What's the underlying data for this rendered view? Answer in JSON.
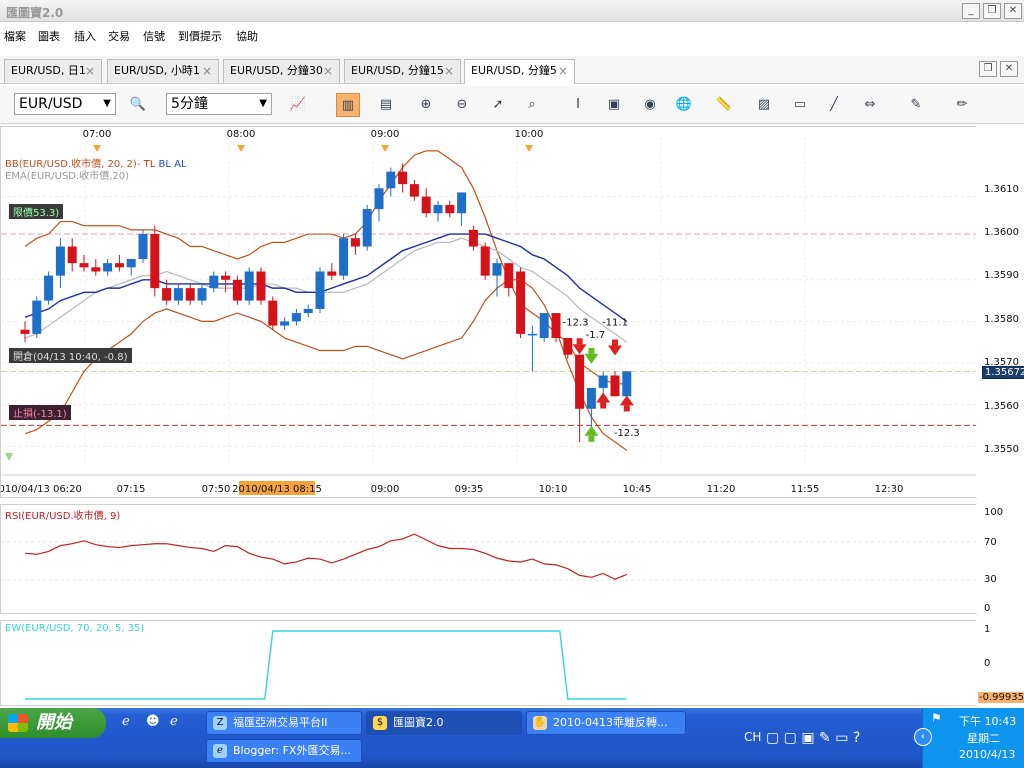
{
  "window": {
    "title": "匯圖寶2.0"
  },
  "menu": [
    "檔案",
    "圖表",
    "插入",
    "交易",
    "信號",
    "到價提示",
    "協助"
  ],
  "tabs": [
    "EUR/USD, 日1",
    "EUR/USD, 小時1",
    "EUR/USD, 分鐘30",
    "EUR/USD, 分鐘15",
    "EUR/USD, 分鐘5"
  ],
  "toolbar": {
    "symbol": "EUR/USD",
    "period": "5分鐘"
  },
  "main_chart": {
    "top_time_labels": [
      "07:00",
      "08:00",
      "09:00",
      "10:00"
    ],
    "bb_label": "BB(EUR/USD.收市價, 20, 2)-",
    "bb_tags": [
      "TL",
      "BL",
      "AL"
    ],
    "ema_label": "EMA(EUR/USD.收市價,20)",
    "order_limit": "限價53.3)",
    "order_entry": "開倉(04/13 10:40, -0.8)",
    "order_stop": "止損(-13.1)",
    "price_ticks": [
      "1.3610",
      "1.3600",
      "1.3590",
      "1.3580",
      "1.3570",
      "1.3560",
      "1.3550"
    ],
    "current_price": "1.35672",
    "bottom_time_labels": [
      "2010/04/13 06:20",
      "07:15",
      "07:50",
      "2010/04/13 08:15",
      "09:00",
      "09:35",
      "10:10",
      "10:45",
      "11:20",
      "11:55",
      "12:30"
    ],
    "signal_labels": [
      "-12.3",
      "-1.7",
      "-11.1",
      "-12.3"
    ]
  },
  "rsi": {
    "label": "RSI(EUR/USD.收市價, 9)",
    "ticks": [
      "100",
      "70",
      "30",
      "0"
    ]
  },
  "ew": {
    "label": "EW(EUR/USD, 70, 20, 5, 35)",
    "ticks": [
      "1",
      "0",
      "-0.99935"
    ]
  },
  "taskbar": {
    "start": "開始",
    "tasks": [
      "福匯亞洲交易平台II",
      "匯圖寶2.0",
      "2010-0413乖離反轉...",
      "Blogger: FX外匯交易..."
    ],
    "lang": "CH",
    "time": "下午 10:43",
    "weekday": "星期二",
    "date": "2010/4/13"
  },
  "colors": {
    "bull": "#1d6fc7",
    "bear": "#d5121a",
    "bb": "#c0501e",
    "ema": "#1b2fa8",
    "ew": "#38d6d6",
    "rsi": "#c22020"
  },
  "chart_data": {
    "type": "candlestick",
    "x": [
      "06:25",
      "06:30",
      "06:35",
      "06:40",
      "06:45",
      "06:50",
      "06:55",
      "07:00",
      "07:05",
      "07:10",
      "07:15",
      "07:20",
      "07:25",
      "07:30",
      "07:35",
      "07:40",
      "07:45",
      "07:50",
      "07:55",
      "08:00",
      "08:05",
      "08:10",
      "08:15",
      "08:20",
      "08:25",
      "08:30",
      "08:35",
      "08:40",
      "08:45",
      "08:50",
      "08:55",
      "09:00",
      "09:05",
      "09:10",
      "09:15",
      "09:20",
      "09:25",
      "09:30",
      "09:35",
      "09:40",
      "09:45",
      "09:50",
      "09:55",
      "10:00",
      "10:05",
      "10:10",
      "10:15",
      "10:20",
      "10:25",
      "10:30",
      "10:35",
      "10:40"
    ],
    "candles": [
      {
        "o": 1.3578,
        "h": 1.358,
        "l": 1.3575,
        "c": 1.3577
      },
      {
        "o": 1.3577,
        "h": 1.3586,
        "l": 1.3576,
        "c": 1.3585
      },
      {
        "o": 1.3585,
        "h": 1.3592,
        "l": 1.3584,
        "c": 1.3591
      },
      {
        "o": 1.3591,
        "h": 1.36,
        "l": 1.3588,
        "c": 1.3598
      },
      {
        "o": 1.3598,
        "h": 1.36,
        "l": 1.3592,
        "c": 1.3594
      },
      {
        "o": 1.3594,
        "h": 1.3596,
        "l": 1.3592,
        "c": 1.3593
      },
      {
        "o": 1.3593,
        "h": 1.3595,
        "l": 1.3591,
        "c": 1.3592
      },
      {
        "o": 1.3592,
        "h": 1.3595,
        "l": 1.3591,
        "c": 1.3594
      },
      {
        "o": 1.3594,
        "h": 1.3596,
        "l": 1.3592,
        "c": 1.3593
      },
      {
        "o": 1.3593,
        "h": 1.3595,
        "l": 1.3591,
        "c": 1.3595
      },
      {
        "o": 1.3595,
        "h": 1.3602,
        "l": 1.3594,
        "c": 1.3601
      },
      {
        "o": 1.3601,
        "h": 1.3603,
        "l": 1.3586,
        "c": 1.3588
      },
      {
        "o": 1.3588,
        "h": 1.359,
        "l": 1.3584,
        "c": 1.3585
      },
      {
        "o": 1.3585,
        "h": 1.3589,
        "l": 1.3584,
        "c": 1.3588
      },
      {
        "o": 1.3588,
        "h": 1.3589,
        "l": 1.3584,
        "c": 1.3585
      },
      {
        "o": 1.3585,
        "h": 1.3589,
        "l": 1.3584,
        "c": 1.3588
      },
      {
        "o": 1.3588,
        "h": 1.3592,
        "l": 1.3587,
        "c": 1.3591
      },
      {
        "o": 1.3591,
        "h": 1.3592,
        "l": 1.3587,
        "c": 1.359
      },
      {
        "o": 1.359,
        "h": 1.3591,
        "l": 1.3584,
        "c": 1.3585
      },
      {
        "o": 1.3585,
        "h": 1.3593,
        "l": 1.3584,
        "c": 1.3592
      },
      {
        "o": 1.3592,
        "h": 1.3593,
        "l": 1.3584,
        "c": 1.3585
      },
      {
        "o": 1.3585,
        "h": 1.3586,
        "l": 1.3578,
        "c": 1.3579
      },
      {
        "o": 1.3579,
        "h": 1.3581,
        "l": 1.3578,
        "c": 1.358
      },
      {
        "o": 1.358,
        "h": 1.3583,
        "l": 1.3579,
        "c": 1.3582
      },
      {
        "o": 1.3582,
        "h": 1.3584,
        "l": 1.3581,
        "c": 1.3583
      },
      {
        "o": 1.3583,
        "h": 1.3593,
        "l": 1.3582,
        "c": 1.3592
      },
      {
        "o": 1.3592,
        "h": 1.3594,
        "l": 1.359,
        "c": 1.3591
      },
      {
        "o": 1.3591,
        "h": 1.3601,
        "l": 1.359,
        "c": 1.36
      },
      {
        "o": 1.36,
        "h": 1.3601,
        "l": 1.3596,
        "c": 1.3598
      },
      {
        "o": 1.3598,
        "h": 1.3608,
        "l": 1.3597,
        "c": 1.3607
      },
      {
        "o": 1.3607,
        "h": 1.3613,
        "l": 1.3604,
        "c": 1.3612
      },
      {
        "o": 1.3612,
        "h": 1.3617,
        "l": 1.361,
        "c": 1.3616
      },
      {
        "o": 1.3616,
        "h": 1.3618,
        "l": 1.3611,
        "c": 1.3613
      },
      {
        "o": 1.3613,
        "h": 1.3614,
        "l": 1.3609,
        "c": 1.361
      },
      {
        "o": 1.361,
        "h": 1.3612,
        "l": 1.3605,
        "c": 1.3606
      },
      {
        "o": 1.3606,
        "h": 1.3609,
        "l": 1.3604,
        "c": 1.3608
      },
      {
        "o": 1.3608,
        "h": 1.3609,
        "l": 1.3605,
        "c": 1.3606
      },
      {
        "o": 1.3606,
        "h": 1.3611,
        "l": 1.3603,
        "c": 1.3611
      },
      {
        "o": 1.3602,
        "h": 1.3603,
        "l": 1.3597,
        "c": 1.3598
      },
      {
        "o": 1.3598,
        "h": 1.3599,
        "l": 1.359,
        "c": 1.3591
      },
      {
        "o": 1.3591,
        "h": 1.3595,
        "l": 1.3586,
        "c": 1.3594
      },
      {
        "o": 1.3594,
        "h": 1.3594,
        "l": 1.3586,
        "c": 1.3588
      },
      {
        "o": 1.3592,
        "h": 1.3593,
        "l": 1.3576,
        "c": 1.3577
      },
      {
        "o": 1.3577,
        "h": 1.3579,
        "l": 1.3568,
        "c": 1.3577
      },
      {
        "o": 1.3576,
        "h": 1.3582,
        "l": 1.3575,
        "c": 1.3582
      },
      {
        "o": 1.3582,
        "h": 1.3582,
        "l": 1.3575,
        "c": 1.3576
      },
      {
        "o": 1.3576,
        "h": 1.3576,
        "l": 1.3571,
        "c": 1.3572
      },
      {
        "o": 1.3572,
        "h": 1.3572,
        "l": 1.3551,
        "c": 1.3559
      },
      {
        "o": 1.3559,
        "h": 1.3564,
        "l": 1.3553,
        "c": 1.3564
      },
      {
        "o": 1.3564,
        "h": 1.3568,
        "l": 1.3561,
        "c": 1.3567
      },
      {
        "o": 1.3567,
        "h": 1.3568,
        "l": 1.3562,
        "c": 1.3562
      },
      {
        "o": 1.3562,
        "h": 1.3568,
        "l": 1.3561,
        "c": 1.3568
      }
    ],
    "bb_upper": [
      1.3598,
      1.36,
      1.3601,
      1.3604,
      1.3604,
      1.3603,
      1.3603,
      1.3603,
      1.3603,
      1.3602,
      1.3602,
      1.3602,
      1.3601,
      1.36,
      1.3598,
      1.3598,
      1.3597,
      1.3596,
      1.3595,
      1.3596,
      1.3598,
      1.3599,
      1.3599,
      1.36,
      1.3601,
      1.3601,
      1.3601,
      1.36,
      1.3601,
      1.3604,
      1.3609,
      1.3613,
      1.3617,
      1.362,
      1.3621,
      1.3621,
      1.3619,
      1.3617,
      1.3612,
      1.3605,
      1.3597,
      1.359,
      1.3584,
      1.3582,
      1.358,
      1.3577,
      1.3575,
      1.357,
      1.3568,
      1.3566,
      1.3565,
      1.3565
    ],
    "bb_lower": [
      1.3553,
      1.3554,
      1.3556,
      1.3558,
      1.3563,
      1.3568,
      1.3571,
      1.3573,
      1.3575,
      1.3577,
      1.358,
      1.3582,
      1.3583,
      1.3582,
      1.3581,
      1.358,
      1.358,
      1.3581,
      1.3582,
      1.3581,
      1.358,
      1.3578,
      1.3576,
      1.3575,
      1.3574,
      1.3573,
      1.3573,
      1.3573,
      1.3574,
      1.3574,
      1.3573,
      1.3572,
      1.3571,
      1.3572,
      1.3573,
      1.3574,
      1.3575,
      1.3576,
      1.358,
      1.3585,
      1.3588,
      1.359,
      1.359,
      1.3588,
      1.3584,
      1.3578,
      1.357,
      1.3563,
      1.3557,
      1.3553,
      1.3551,
      1.3549
    ],
    "ema": [
      1.3581,
      1.3582,
      1.3583,
      1.3585,
      1.3586,
      1.3587,
      1.3587,
      1.3588,
      1.3588,
      1.3589,
      1.359,
      1.359,
      1.3589,
      1.3589,
      1.3589,
      1.3589,
      1.3589,
      1.3589,
      1.3589,
      1.3589,
      1.3589,
      1.3588,
      1.3588,
      1.3587,
      1.3587,
      1.3587,
      1.3588,
      1.3589,
      1.359,
      1.3591,
      1.3593,
      1.3595,
      1.3597,
      1.3598,
      1.3599,
      1.36,
      1.3601,
      1.3601,
      1.3601,
      1.3601,
      1.36,
      1.3599,
      1.3598,
      1.3596,
      1.3595,
      1.3593,
      1.3591,
      1.3588,
      1.3586,
      1.3584,
      1.3582,
      1.358
    ],
    "sma": [
      1.3576,
      1.3577,
      1.3579,
      1.3581,
      1.3583,
      1.3585,
      1.3587,
      1.3588,
      1.3589,
      1.359,
      1.3591,
      1.3591,
      1.3592,
      1.3591,
      1.359,
      1.3589,
      1.3588,
      1.3588,
      1.3588,
      1.3588,
      1.3589,
      1.3589,
      1.3588,
      1.3588,
      1.3587,
      1.3587,
      1.3587,
      1.3587,
      1.3588,
      1.3589,
      1.3591,
      1.3593,
      1.3595,
      1.3597,
      1.3598,
      1.3599,
      1.3599,
      1.36,
      1.3599,
      1.3598,
      1.3597,
      1.3595,
      1.3593,
      1.3592,
      1.359,
      1.3588,
      1.3586,
      1.3583,
      1.3581,
      1.3579,
      1.3577,
      1.3575
    ],
    "rsi": [
      58,
      57,
      60,
      66,
      68,
      71,
      67,
      65,
      64,
      66,
      67,
      68,
      68,
      66,
      64,
      63,
      60,
      66,
      65,
      58,
      54,
      52,
      47,
      49,
      53,
      52,
      48,
      52,
      57,
      62,
      65,
      71,
      73,
      78,
      72,
      66,
      63,
      63,
      62,
      58,
      53,
      50,
      49,
      52,
      47,
      46,
      42,
      35,
      33,
      37,
      31,
      36
    ],
    "ew": [
      -1,
      -1,
      -1,
      -1,
      -1,
      -1,
      -1,
      -1,
      -1,
      -1,
      -1,
      -1,
      -1,
      -1,
      -1,
      -1,
      -1,
      -1,
      -1,
      -1,
      -1,
      1,
      1,
      1,
      1,
      1,
      1,
      1,
      1,
      1,
      1,
      1,
      1,
      1,
      1,
      1,
      1,
      1,
      1,
      1,
      1,
      1,
      1,
      1,
      1,
      1,
      -1,
      -1,
      -1,
      -1,
      -1,
      -1
    ],
    "ylim": [
      1.3545,
      1.362
    ]
  }
}
